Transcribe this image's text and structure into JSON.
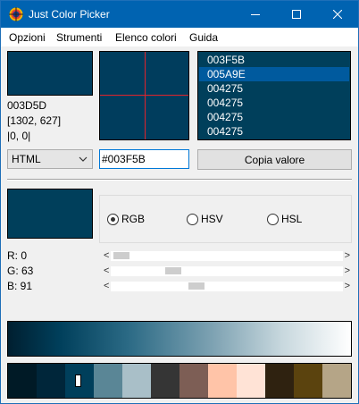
{
  "window": {
    "title": "Just Color Picker"
  },
  "menu": [
    "Opzioni",
    "Strumenti",
    "Elenco colori",
    "Guida"
  ],
  "current": {
    "hex": "003D5D",
    "screen_coords": "[1302, 627]",
    "offset": "|0, 0|"
  },
  "history": [
    "003F5B",
    "005A9E",
    "004275",
    "004275",
    "004275",
    "004275"
  ],
  "history_selected_index": 1,
  "format": {
    "selected": "HTML"
  },
  "value_field": "#003F5B",
  "copy_button": "Copia valore",
  "modes": [
    {
      "label": "RGB",
      "checked": true
    },
    {
      "label": "HSV",
      "checked": false
    },
    {
      "label": "HSL",
      "checked": false
    }
  ],
  "sliders": [
    {
      "label": "R: 0",
      "value": 0
    },
    {
      "label": "G: 63",
      "value": 63
    },
    {
      "label": "B: 91",
      "value": 91
    }
  ],
  "palette": [
    "#001a26",
    "#00263a",
    "#003f5b",
    "#5a8696",
    "#a9bfc8",
    "#353535",
    "#7d5e55",
    "#ffc4a8",
    "#ffe3d6",
    "#2f2210",
    "#5b430e",
    "#b5a587"
  ],
  "palette_selected_index": 2,
  "colors": {
    "title_bar": "#0063b1",
    "selection": "#005a9e",
    "current": "#003d5d",
    "picked": "#003f5b",
    "crosshair": "#e0242d"
  }
}
